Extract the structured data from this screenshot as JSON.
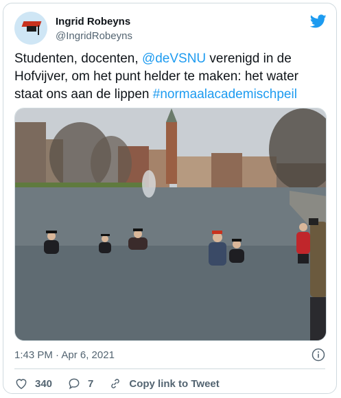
{
  "author": {
    "name": "Ingrid Robeyns",
    "handle": "@IngridRobeyns"
  },
  "tweet": {
    "text_part1": "Studenten, docenten, ",
    "mention": "@deVSNU",
    "text_part2": " verenigd in de Hofvijver, om het punt helder te maken: het water staat ons aan de lippen ",
    "hashtag": "#normaalacademischpeil"
  },
  "meta": {
    "timestamp": "1:43 PM · Apr 6, 2021"
  },
  "actions": {
    "likes": "340",
    "replies": "7",
    "copy_link": "Copy link to Tweet"
  },
  "icons": {
    "brand": "twitter-bird-icon",
    "info": "info-icon",
    "like": "heart-icon",
    "reply": "reply-icon",
    "link": "link-icon"
  },
  "colors": {
    "accent": "#1d9bf0",
    "secondary_text": "#536471",
    "border": "#cfd9de"
  }
}
